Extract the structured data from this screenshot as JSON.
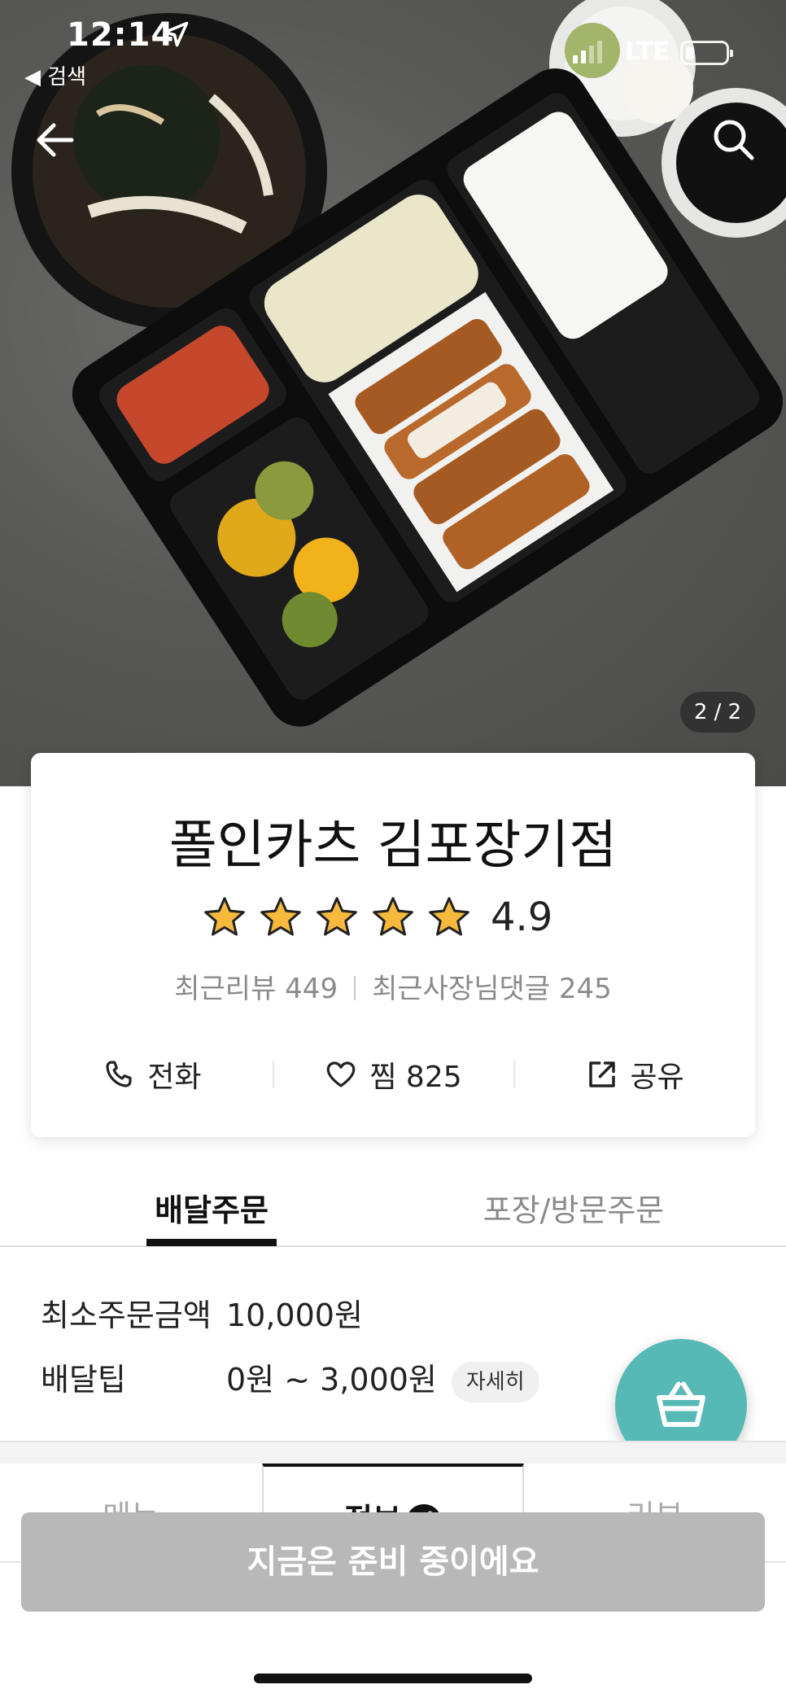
{
  "status_bar": {
    "time": "12:14",
    "back_label": "◀ 검색",
    "network": "LTE"
  },
  "hero": {
    "photo_counter": "2 / 2",
    "alt": "photo",
    "back_icon": "arrow-left-icon",
    "search_icon": "search-icon"
  },
  "store": {
    "name": "폴인카츠 김포장기점",
    "rating_value": 4.9,
    "rating_text": "4.9",
    "rating_stars": 5,
    "recent_reviews": "최근리뷰 449",
    "owner_replies": "최근사장님댓글 245",
    "actions": {
      "call": "전화",
      "favorite": "찜 825",
      "share": "공유"
    }
  },
  "order_tabs": {
    "delivery": "배달주문",
    "pickup": "포장/방문주문",
    "active": "delivery"
  },
  "delivery_info": {
    "min_order_label": "최소주문금액",
    "min_order_value": "10,000원",
    "tip_label": "배달팁",
    "tip_value": "0원 ~ 3,000원",
    "detail_chip": "자세히"
  },
  "menu_tabs": {
    "menu": "메뉴",
    "info": "정보",
    "reviews": "리뷰",
    "active": "info"
  },
  "bottom_button": {
    "label": "지금은 준비 중이에요"
  },
  "colors": {
    "accent": "#57b9b6",
    "disabled_button": "#b8b8b8",
    "star": "#f6b93b",
    "text_primary": "#111111",
    "text_muted": "#8a8a8a"
  }
}
